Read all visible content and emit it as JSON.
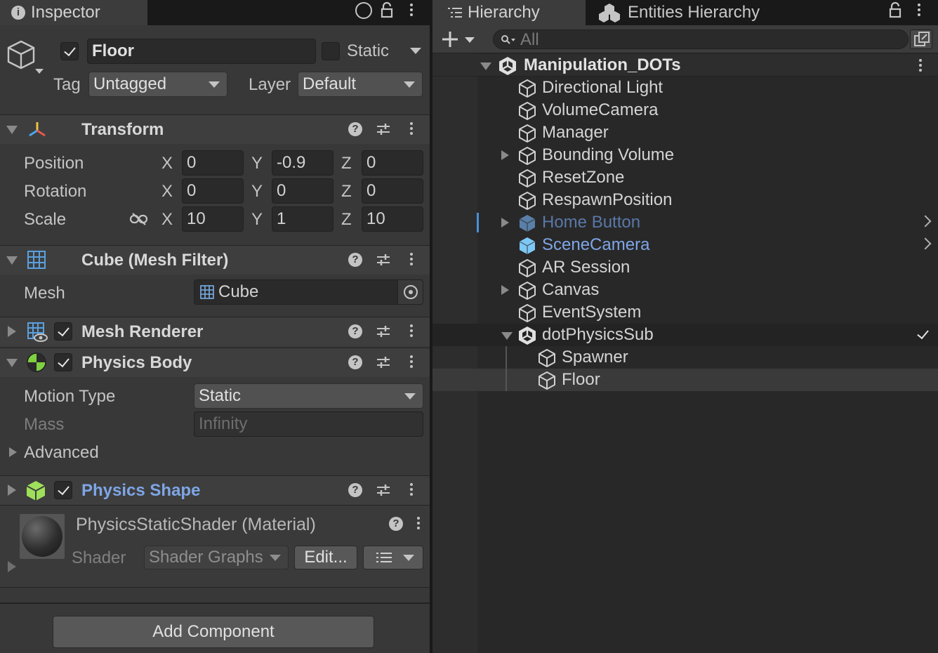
{
  "inspector": {
    "tab_label": "Inspector",
    "object": {
      "name": "Floor",
      "active": true,
      "static_label": "Static",
      "static_checked": false,
      "tag_label": "Tag",
      "tag_value": "Untagged",
      "layer_label": "Layer",
      "layer_value": "Default"
    },
    "transform": {
      "title": "Transform",
      "rows": [
        {
          "label": "Position",
          "x": "0",
          "y": "-0.9",
          "z": "0"
        },
        {
          "label": "Rotation",
          "x": "0",
          "y": "0",
          "z": "0"
        },
        {
          "label": "Scale",
          "x": "10",
          "y": "1",
          "z": "10"
        }
      ],
      "axis_x": "X",
      "axis_y": "Y",
      "axis_z": "Z"
    },
    "mesh_filter": {
      "title": "Cube (Mesh Filter)",
      "mesh_label": "Mesh",
      "mesh_value": "Cube"
    },
    "mesh_renderer": {
      "title": "Mesh Renderer",
      "enabled": true
    },
    "physics_body": {
      "title": "Physics Body",
      "enabled": true,
      "motion_type_label": "Motion Type",
      "motion_type_value": "Static",
      "mass_label": "Mass",
      "mass_value": "Infinity",
      "advanced_label": "Advanced"
    },
    "physics_shape": {
      "title": "Physics Shape",
      "enabled": true,
      "title_color": "#7ea6e6"
    },
    "material": {
      "title": "PhysicsStaticShader (Material)",
      "shader_label": "Shader",
      "shader_value": "Shader Graphs",
      "edit_label": "Edit..."
    },
    "add_component_label": "Add Component"
  },
  "hierarchy": {
    "tab_label": "Hierarchy",
    "entities_tab_label": "Entities Hierarchy",
    "search_placeholder": "All",
    "scene_name": "Manipulation_DOTs",
    "items": [
      {
        "label": "Directional Light",
        "depth": 1,
        "expandable": false
      },
      {
        "label": "VolumeCamera",
        "depth": 1,
        "expandable": false
      },
      {
        "label": "Manager",
        "depth": 1,
        "expandable": false
      },
      {
        "label": "Bounding Volume",
        "depth": 1,
        "expandable": true
      },
      {
        "label": "ResetZone",
        "depth": 1,
        "expandable": false
      },
      {
        "label": "RespawnPosition",
        "depth": 1,
        "expandable": false
      },
      {
        "label": "Home Button",
        "depth": 1,
        "expandable": true,
        "prefab": true,
        "disabled": true
      },
      {
        "label": "SceneCamera",
        "depth": 1,
        "expandable": false,
        "prefab": true
      },
      {
        "label": "AR Session",
        "depth": 1,
        "expandable": false
      },
      {
        "label": "Canvas",
        "depth": 1,
        "expandable": true
      },
      {
        "label": "EventSystem",
        "depth": 1,
        "expandable": false
      },
      {
        "label": "dotPhysicsSub",
        "depth": 1,
        "expandable": true,
        "expanded": true,
        "subscene": true
      },
      {
        "label": "Spawner",
        "depth": 2,
        "expandable": false
      },
      {
        "label": "Floor",
        "depth": 2,
        "expandable": false,
        "selected": true
      }
    ],
    "colors": {
      "prefab_text": "#7ea6e6",
      "prefab_disabled_text": "#5a78a8",
      "selection_row": "#3a3a3a"
    }
  }
}
